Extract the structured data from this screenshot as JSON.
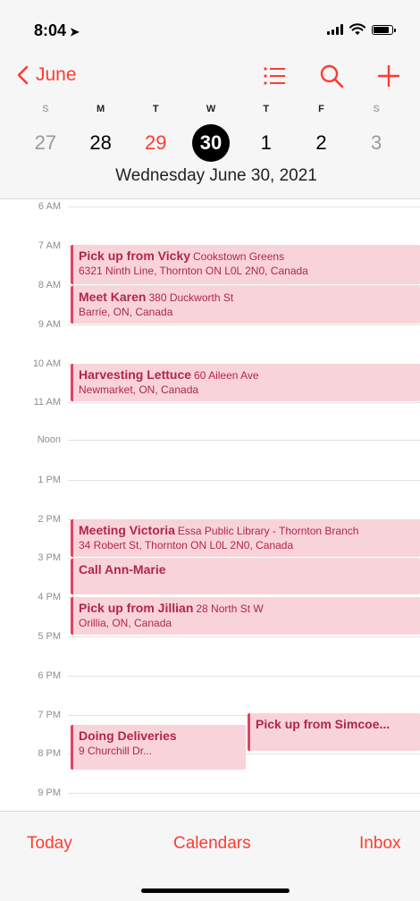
{
  "status": {
    "time": "8:04",
    "location_icon": "location-arrow-icon"
  },
  "nav": {
    "back_label": "June",
    "icons": [
      "list-icon",
      "search-icon",
      "add-icon"
    ]
  },
  "week": {
    "weekdays": [
      "S",
      "M",
      "T",
      "W",
      "T",
      "F",
      "S"
    ],
    "dates": [
      "27",
      "28",
      "29",
      "30",
      "1",
      "2",
      "3"
    ],
    "selected_index": 3,
    "today_index": 2
  },
  "date_title": "Wednesday  June 30, 2021",
  "hours": [
    "6 AM",
    "7 AM",
    "8 AM",
    "9 AM",
    "10 AM",
    "11 AM",
    "Noon",
    "1 PM",
    "2 PM",
    "3 PM",
    "4 PM",
    "5 PM",
    "6 PM",
    "7 PM",
    "8 PM",
    "9 PM"
  ],
  "events": [
    {
      "title": "Pick up from Vicky",
      "location": "Cookstown Greens",
      "subtitle": "6321 Ninth Line, Thornton ON L0L 2N0, Canada"
    },
    {
      "title": "Meet Karen",
      "location": "380 Duckworth St",
      "subtitle": "Barrie, ON, Canada"
    },
    {
      "title": "Harvesting Lettuce",
      "location": "60 Aileen Ave",
      "subtitle": "Newmarket, ON, Canada"
    },
    {
      "title": "Meeting Victoria",
      "location": "Essa Public Library - Thornton Branch",
      "subtitle": "34 Robert St, Thornton ON L0L 2N0, Canada"
    },
    {
      "title": "Call Ann-Marie",
      "location": "",
      "subtitle": ""
    },
    {
      "title": "Pick up from Jillian",
      "location": "28 North St W",
      "subtitle": "Orillia, ON, Canada"
    },
    {
      "title": "Doing Deliveries",
      "location": "",
      "subtitle": "9 Churchill Dr..."
    },
    {
      "title": "Pick up from Simcoe...",
      "location": "",
      "subtitle": ""
    }
  ],
  "tabs": {
    "today": "Today",
    "calendars": "Calendars",
    "inbox": "Inbox"
  },
  "colors": {
    "accent": "#ff3b30",
    "event_bg": "#f9d3da",
    "event_text": "#b02748",
    "event_bar": "#e0425f"
  }
}
